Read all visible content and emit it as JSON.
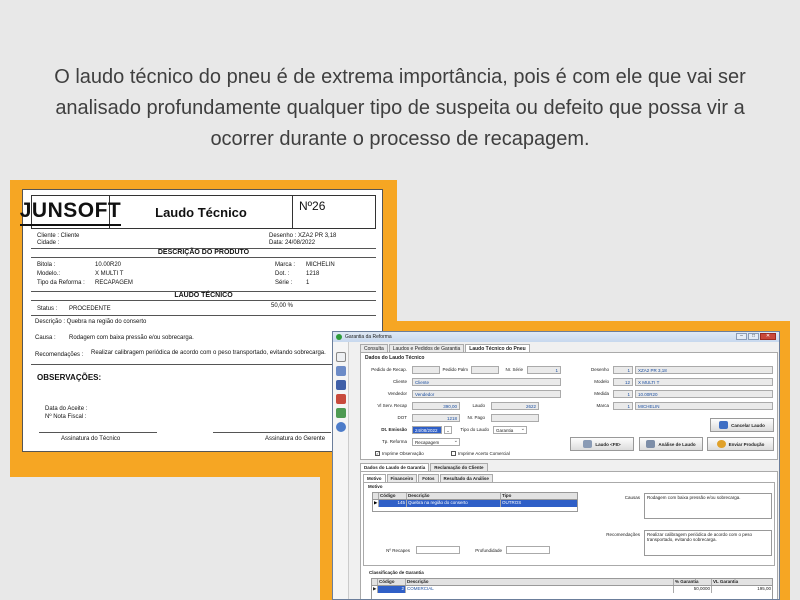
{
  "intro": "O laudo técnico do pneu é de extrema importância, pois é com ele que vai ser analisado profundamente qualquer tipo de suspeita ou defeito que possa vir a ocorrer durante o processo de recapagem.",
  "report": {
    "logo": "JUNSOFT",
    "title": "Laudo Técnico",
    "number": "Nº26",
    "cliente": "Cliente :  Cliente",
    "cidade": "Cidade :",
    "desenho": "Desenho :  XZA2 PR 3,18",
    "data": "Data:       24/08/2022",
    "sec_produto": "DESCRIÇÃO DO PRODUTO",
    "bitola": "Bitola :",
    "bitola_val": "10.00R20",
    "modelo": "Modelo.:",
    "modelo_val": "X MULTI T",
    "tipo": "Tipo da Reforma :",
    "tipo_val": "RECAPAGEM",
    "marca": "Marca :",
    "marca_val": "MICHELIN",
    "dot": "Dot. :",
    "dot_val": "1218",
    "serie": "Série :",
    "serie_val": "1",
    "sec_laudo": "LAUDO TÉCNICO",
    "percent": "50,00 %",
    "status": "Status :",
    "status_val": "PROCEDENTE",
    "descricao": "Descrição :  Quebra na região do conserto",
    "causa": "Causa :",
    "causa_val": "Rodagem com baixa pressão e/ou sobrecarga.",
    "recomendacoes": "Recomendações :",
    "recomendacoes_val": "Realizar calibragem periódica de acordo com o peso transportado, evitando sobrecarga.",
    "observacoes": "OBSERVAÇÕES:",
    "data_aceite": "Data do Aceite :",
    "nota_fiscal": "Nº Nota Fiscal :",
    "assin_tecnico": "Assinatura do Técnico",
    "assin_gerente": "Assinatura do Gerente"
  },
  "window": {
    "title": "Garantia da Reforma",
    "tabs": [
      "Consulta",
      "Laudos e Pedidos de Garantia",
      "Laudo Técnico do Pneu"
    ],
    "section_title": "Dados do Laudo Técnico",
    "fields": {
      "pedido_recap_label": "Pedido de Recap.",
      "pedido_palm_label": "Pedido Palm",
      "nr_serie_label": "Nr. Série",
      "nr_serie": "1",
      "cliente_label": "Cliente",
      "cliente": "Cliente",
      "vendedor_label": "Vendedor",
      "vendedor": "Vendedor",
      "vlserv_label": "Vl Serv. Recap",
      "vlserv": "390,00",
      "laudo_label": "Laudo",
      "laudo": "2622",
      "dot_label": "DOT",
      "dot": "1218",
      "nr_pago_label": "Nr. Pago",
      "dt_emissao_label": "Dt. Emissão",
      "dt_emissao": "24/08/2022",
      "tipo_laudo_label": "Tipo do Laudo",
      "tipo_laudo": "Garantia",
      "tp_reforma_label": "Tp. Reforma",
      "tp_reforma": "Recapagem",
      "desenho_label": "Desenho",
      "desenho_code": "1",
      "desenho": "XZA2 PR 3,18",
      "modelo_label": "Modelo",
      "modelo_code": "12",
      "modelo": "X MULTI T",
      "medida_label": "Medida",
      "medida_code": "1",
      "medida": "10.00R20",
      "marca_label": "Marca",
      "marca_code": "1",
      "marca": "MICHELIN"
    },
    "checks": {
      "imprime_obs": "Imprime Observação",
      "imprime_acerto": "Imprime Acerto Comercial"
    },
    "buttons": {
      "cancelar": "Cancelar Laudo",
      "laudo": "Laudo <F8>",
      "analise": "Análise de Laudo",
      "enviar": "Enviar Produção"
    },
    "subtabs1": [
      "Dados do Laudo de Garantia",
      "Reclamação do Cliente"
    ],
    "subtabs2": [
      "Motivo",
      "Financeiro",
      "Fotos",
      "Resultado da Análise"
    ],
    "motivo_title": "Motivo",
    "motivo_headers": [
      "Código",
      "Descrição",
      "Tipo"
    ],
    "motivo_row": [
      "145",
      "Quebra na região do conserto",
      "OUTROS"
    ],
    "causas_label": "Causas",
    "causas": "Rodagem com baixa pressão e/ou sobrecarga.",
    "recom_label": "Recomendações",
    "recom": "Realizar calibragem periódica de acordo com o peso transportado, evitando sobrecarga.",
    "nr_recapes_label": "Nº Recapes",
    "profundidade_label": "Profundidade",
    "class_title": "Classificação de Garantia",
    "class_headers": [
      "Código",
      "Descrição",
      "% Garantia",
      "VL Garantia"
    ],
    "class_row": [
      "2",
      "COMERCIAL",
      "50,0000",
      "195,00"
    ]
  }
}
